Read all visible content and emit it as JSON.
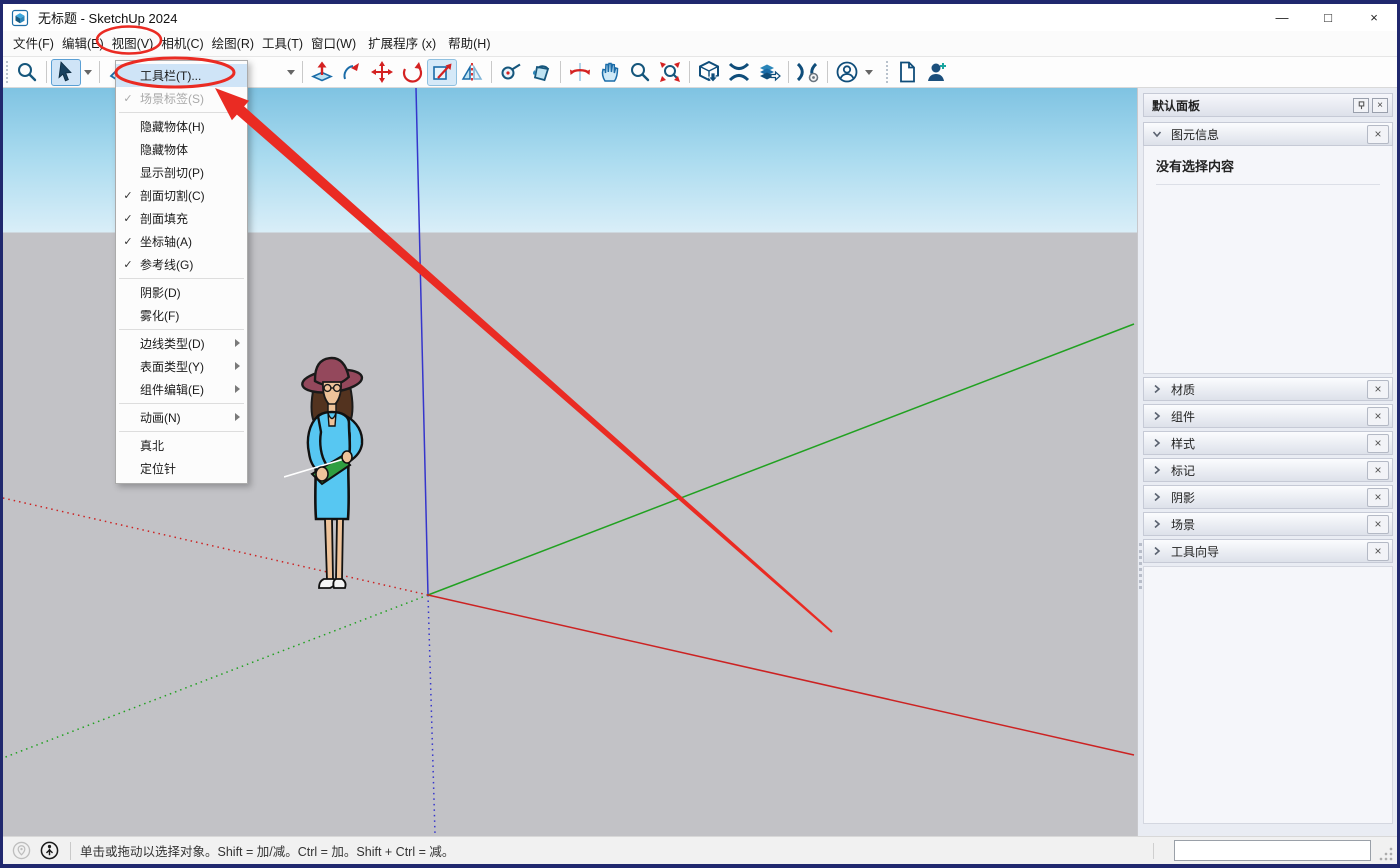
{
  "window": {
    "title": "无标题 - SketchUp 2024",
    "controls": {
      "minimize": "—",
      "maximize": "□",
      "close": "×"
    }
  },
  "menu_bar": {
    "items": [
      "文件(F)",
      "编辑(E)",
      "视图(V)",
      "相机(C)",
      "绘图(R)",
      "工具(T)",
      "窗口(W)",
      "扩展程序 (x)",
      "帮助(H)"
    ]
  },
  "view_menu": {
    "items": [
      {
        "label": "工具栏(T)...",
        "check": "",
        "highlighted": true
      },
      {
        "label": "场景标签(S)",
        "check": "✓",
        "disabled": true
      },
      {
        "label": "隐藏物体(H)",
        "check": ""
      },
      {
        "label": "隐藏物体",
        "check": ""
      },
      {
        "label": "显示剖切(P)",
        "check": ""
      },
      {
        "label": "剖面切割(C)",
        "check": "✓"
      },
      {
        "label": "剖面填充",
        "check": "✓"
      },
      {
        "label": "坐标轴(A)",
        "check": "✓"
      },
      {
        "label": "参考线(G)",
        "check": "✓"
      },
      {
        "label": "阴影(D)",
        "check": ""
      },
      {
        "label": "雾化(F)",
        "check": ""
      },
      {
        "label": "边线类型(D)",
        "check": "",
        "submenu": true
      },
      {
        "label": "表面类型(Y)",
        "check": "",
        "submenu": true
      },
      {
        "label": "组件编辑(E)",
        "check": "",
        "submenu": true
      },
      {
        "label": "动画(N)",
        "check": "",
        "submenu": true
      },
      {
        "label": "真北",
        "check": ""
      },
      {
        "label": "定位针",
        "check": ""
      }
    ]
  },
  "toolbar": {
    "tools": [
      "zoom",
      "select",
      "select-dropdown",
      "eraser",
      "shapes-dropdown",
      "push-pull",
      "follow-me",
      "move",
      "rotate",
      "scale",
      "flip",
      "tape-measure",
      "paint-bucket",
      "orbit",
      "pan",
      "zoom-tool",
      "zoom-extents",
      "3d-warehouse",
      "extension-warehouse",
      "share-model",
      "extension-manager",
      "account",
      "new-document",
      "add-person"
    ]
  },
  "tray": {
    "title": "默认面板",
    "entity_info": {
      "title": "图元信息",
      "empty_message": "没有选择内容"
    },
    "sections": [
      "材质",
      "组件",
      "样式",
      "标记",
      "阴影",
      "场景",
      "工具向导"
    ],
    "close_glyph": "×"
  },
  "status_bar": {
    "hint": "单击或拖动以选择对象。Shift = 加/减。Ctrl = 加。Shift + Ctrl = 减。",
    "measurement_value": ""
  },
  "colors": {
    "annotation_red": "#ea2b23",
    "axis_red": "#cc2222",
    "axis_green": "#21a121",
    "axis_blue": "#3535cc",
    "sky_top": "#7fc3e2",
    "sky_horizon": "#d9eef8",
    "ground": "#c2c2c6",
    "window_border": "#20286e",
    "menu_highlight": "#cfe4f7"
  }
}
